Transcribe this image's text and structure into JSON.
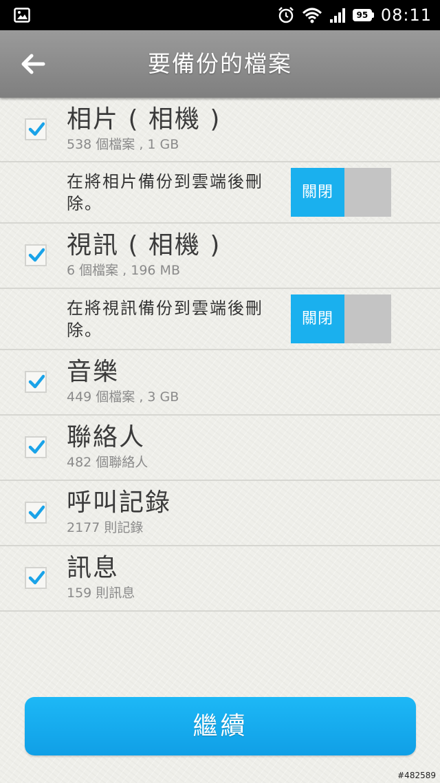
{
  "status_bar": {
    "battery": "95",
    "time": "08:11",
    "icons": [
      "gallery-icon",
      "alarm-icon",
      "wifi-icon",
      "signal-icon",
      "battery-icon"
    ]
  },
  "header": {
    "title": "要備份的檔案",
    "back_icon": "back-arrow-icon"
  },
  "items": [
    {
      "title": "相片 ( 相機 )",
      "subtitle": "538 個檔案 , 1 GB",
      "checked": true
    },
    {
      "title": "視訊 ( 相機 )",
      "subtitle": "6 個檔案 , 196 MB",
      "checked": true
    },
    {
      "title": "音樂",
      "subtitle": "449 個檔案 , 3 GB",
      "checked": true
    },
    {
      "title": "聯絡人",
      "subtitle": "482 個聯絡人",
      "checked": true
    },
    {
      "title": "呼叫記錄",
      "subtitle": "2177 則記錄",
      "checked": true
    },
    {
      "title": "訊息",
      "subtitle": "159 則訊息",
      "checked": true
    }
  ],
  "toggles": [
    {
      "label": "在將相片備份到雲端後刪除。",
      "state": "關閉"
    },
    {
      "label": "在將視訊備份到雲端後刪除。",
      "state": "關閉"
    }
  ],
  "continue_label": "繼續",
  "watermark": "#482589",
  "colors": {
    "accent": "#1ab0ee",
    "check": "#1aa3e8",
    "header": "#8c8c8c",
    "toggle_off": "#c4c4c4"
  }
}
